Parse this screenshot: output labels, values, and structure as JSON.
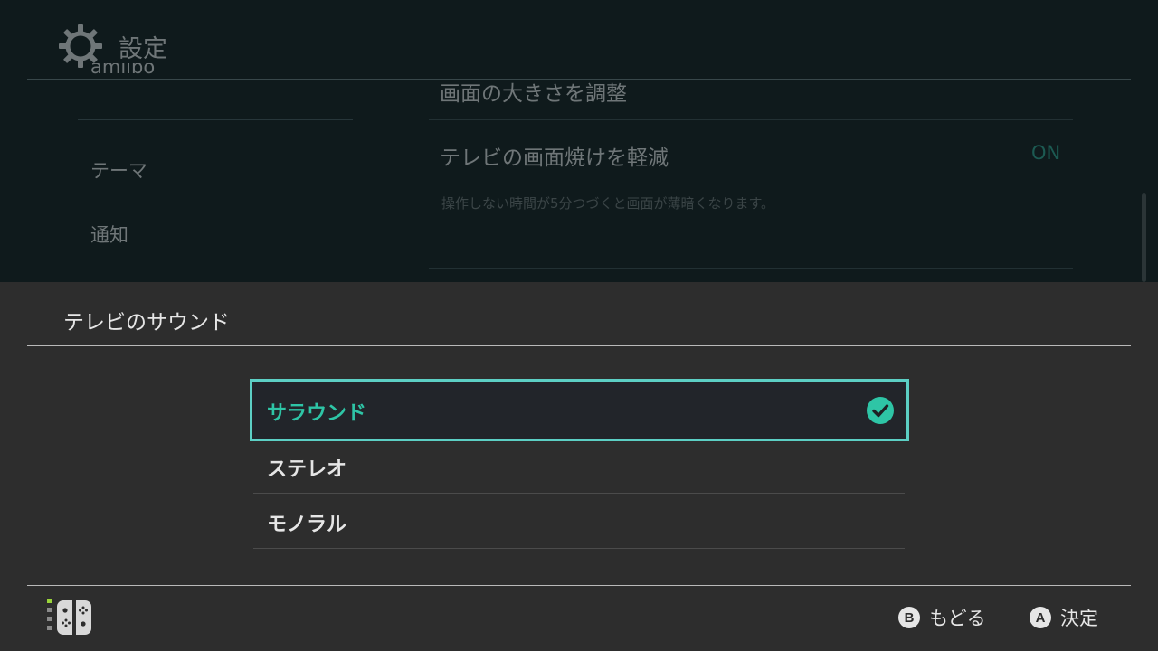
{
  "header": {
    "title": "設定",
    "icon": "gear-icon"
  },
  "sidebar": {
    "items": [
      {
        "label": "amiibo"
      },
      {
        "label": "テーマ"
      },
      {
        "label": "通知"
      }
    ]
  },
  "content": {
    "items": [
      {
        "label": "画面の大きさを調整"
      },
      {
        "label": "テレビの画面焼けを軽減",
        "value": "ON"
      }
    ],
    "description": "操作しない時間が5分つづくと画面が薄暗くなります。"
  },
  "dialog": {
    "title": "テレビのサウンド",
    "options": [
      {
        "label": "サラウンド",
        "selected": true
      },
      {
        "label": "ステレオ",
        "selected": false
      },
      {
        "label": "モノラル",
        "selected": false
      }
    ]
  },
  "footer": {
    "back": {
      "glyph": "B",
      "label": "もどる"
    },
    "confirm": {
      "glyph": "A",
      "label": "決定"
    }
  },
  "colors": {
    "accent": "#2ec5a6",
    "selection_border": "#5ccfc4",
    "panel_bg": "#2d2d2d",
    "background": "#0f1a1c"
  }
}
